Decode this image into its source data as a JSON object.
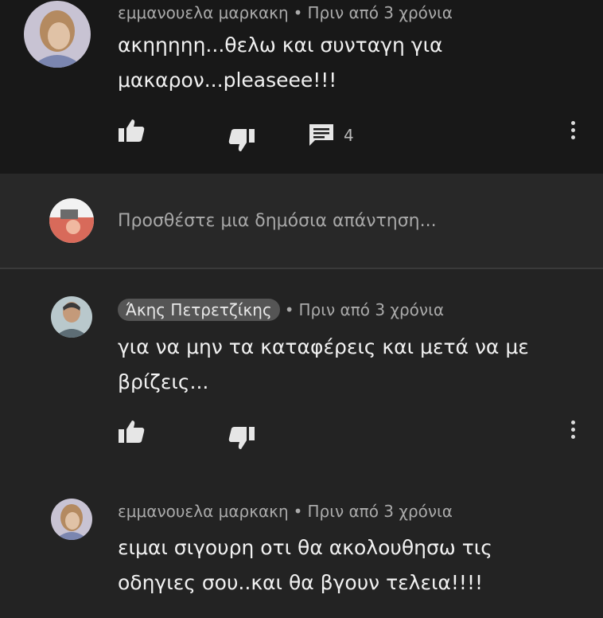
{
  "comments": [
    {
      "author": "εμμανουελα μαρκακη",
      "time": "Πριν από 3 χρόνια",
      "text_line1": "ακηηηηη...θελω και συνταγη για",
      "text_line2": "μακαρον...pleaseee!!!",
      "reply_count": "4"
    },
    {
      "author": "Άκης Πετρετζίκης",
      "time": "Πριν από 3 χρόνια",
      "text_line1": "για να μην τα καταφέρεις και μετά να με",
      "text_line2": "βρίζεις..."
    },
    {
      "author": "εμμανουελα μαρκακη",
      "time": "Πριν από 3 χρόνια",
      "text_line1": "ειμαι σιγουρη οτι θα ακολουθησω τις",
      "text_line2": "οδηγιες σου..και θα βγουν τελεια!!!!"
    }
  ],
  "reply_box": {
    "placeholder": "Προσθέστε μια δημόσια απάντηση..."
  },
  "separator": "•",
  "icons": [
    "thumbs-up-icon",
    "thumbs-down-icon",
    "reply-icon",
    "more-vertical-icon"
  ]
}
